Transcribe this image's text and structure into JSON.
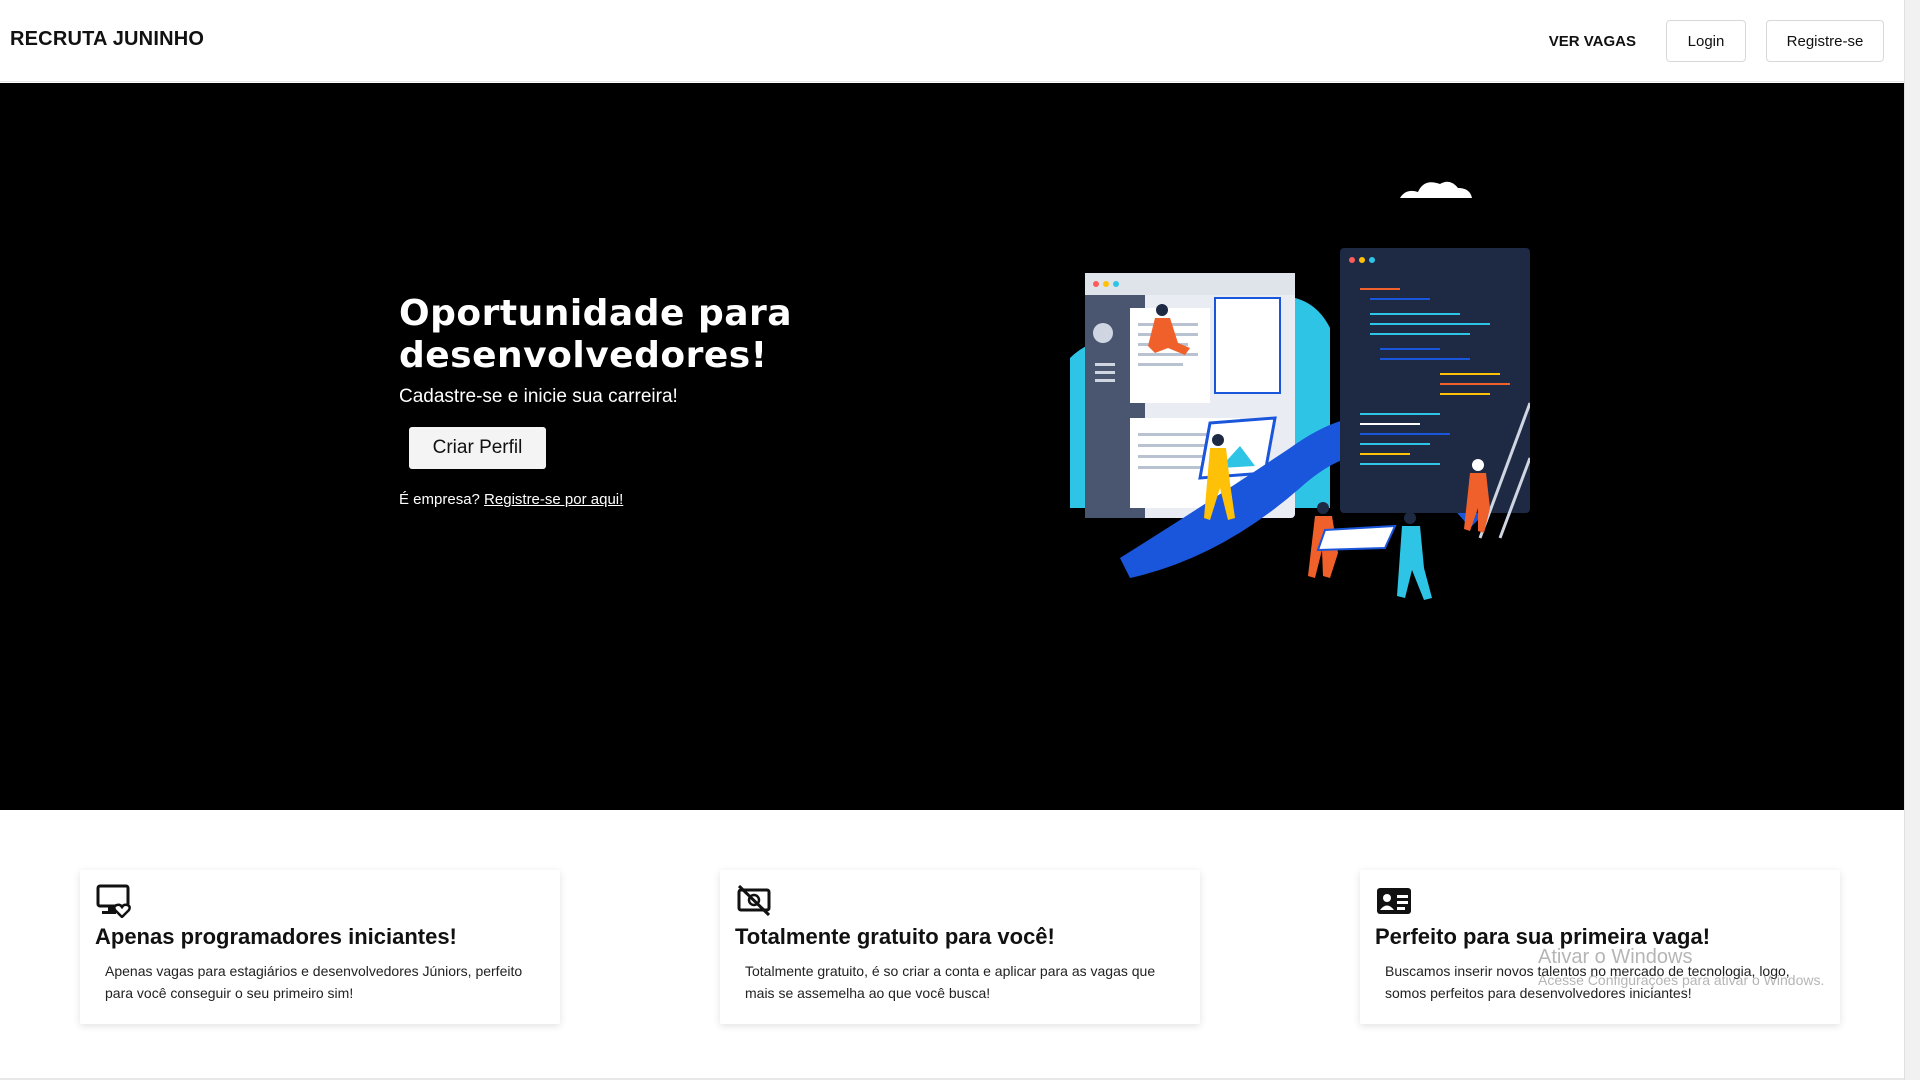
{
  "navbar": {
    "brand": "RECRUTA JUNINHO",
    "jobs_link": "VER VAGAS",
    "login_label": "Login",
    "register_label": "Registre-se"
  },
  "hero": {
    "title": "Oportunidade para desenvolvedores!",
    "subtitle": "Cadastre-se e inicie sua carreira!",
    "cta_label": "Criar Perfil",
    "company_question": "É empresa?",
    "company_link": "Registre-se por aqui!"
  },
  "features": [
    {
      "icon": "monitor-heart-icon",
      "title": "Apenas programadores iniciantes!",
      "text": "Apenas vagas para estagiários e desenvolvedores Júniors, perfeito para você conseguir o seu primeiro sim!"
    },
    {
      "icon": "no-money-icon",
      "title": "Totalmente gratuito para você!",
      "text": "Totalmente gratuito, é so criar a conta e aplicar para as vagas que mais se assemelha ao que você busca!"
    },
    {
      "icon": "id-card-icon",
      "title": "Perfeito para sua primeira vaga!",
      "text": "Buscamos inserir novos talentos no mercado de tecnologia, logo, somos perfeitos para desenvolvedores iniciantes!"
    }
  ],
  "watermark": {
    "title": "Ativar o Windows",
    "text": "Acesse Configurações para ativar o Windows."
  },
  "colors": {
    "hero_bg": "#000000",
    "accent_blue": "#1a56db",
    "accent_cyan": "#2ec4e6",
    "accent_orange": "#f0602a",
    "panel_dark": "#1e2a44"
  }
}
